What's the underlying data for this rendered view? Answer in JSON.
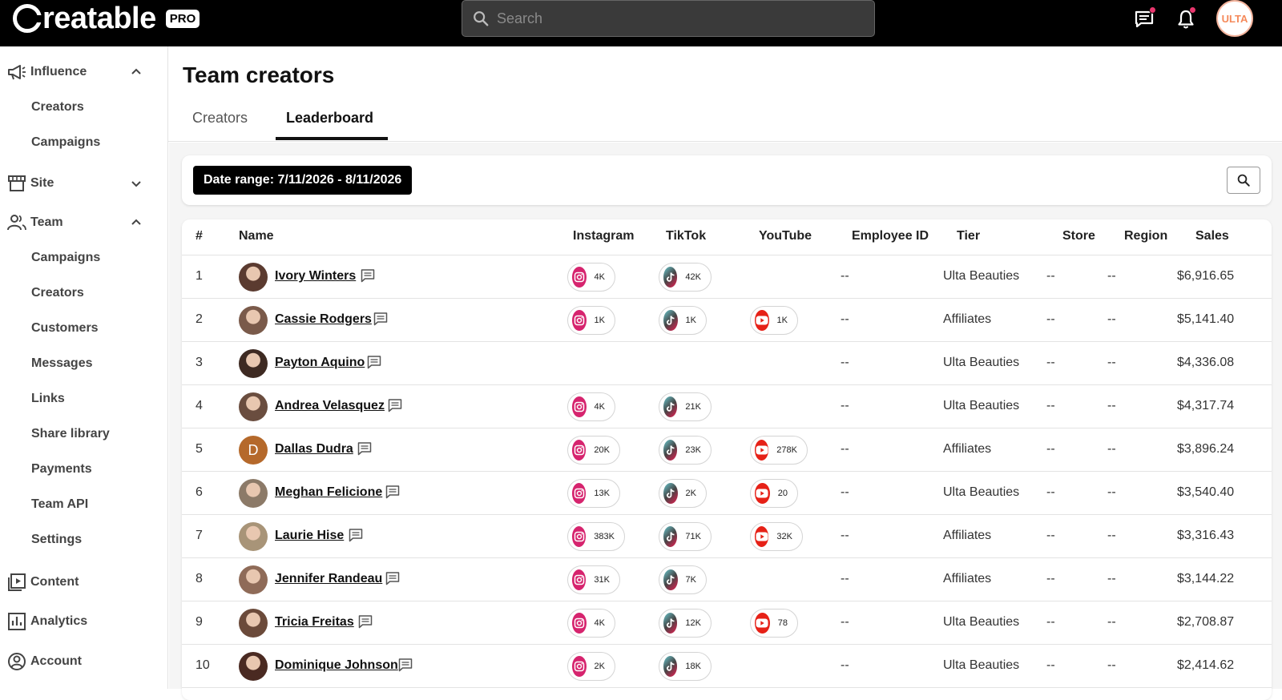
{
  "header": {
    "logo": "Creatable",
    "logo_rest": "reatable",
    "pro_badge": "PRO",
    "search_placeholder": "Search",
    "avatar_text": "ULTA"
  },
  "sidebar": {
    "influence": {
      "label": "Influence",
      "items": [
        "Creators",
        "Campaigns"
      ]
    },
    "site": {
      "label": "Site"
    },
    "team": {
      "label": "Team",
      "items": [
        "Campaigns",
        "Creators",
        "Customers",
        "Messages",
        "Links",
        "Share library",
        "Payments",
        "Team API",
        "Settings"
      ]
    },
    "content": {
      "label": "Content"
    },
    "analytics": {
      "label": "Analytics"
    },
    "account": {
      "label": "Account"
    }
  },
  "main": {
    "title": "Team creators",
    "tabs": [
      "Creators",
      "Leaderboard"
    ],
    "active_tab": "Leaderboard",
    "date_range": "Date range: 7/11/2026 - 8/11/2026"
  },
  "table": {
    "columns": [
      "#",
      "Name",
      "Instagram",
      "TikTok",
      "YouTube",
      "Employee ID",
      "Tier",
      "Store",
      "Region",
      "Sales"
    ],
    "rows": [
      {
        "rank": "1",
        "name": "Ivory Winters",
        "instagram": "4K",
        "tiktok": "42K",
        "youtube": null,
        "employee_id": "--",
        "tier": "Ulta Beauties",
        "store": "--",
        "region": "--",
        "sales": "$6,916.65"
      },
      {
        "rank": "2",
        "name": "Cassie Rodgers",
        "instagram": "1K",
        "tiktok": "1K",
        "youtube": "1K",
        "employee_id": "--",
        "tier": "Affiliates",
        "store": "--",
        "region": "--",
        "sales": "$5,141.40"
      },
      {
        "rank": "3",
        "name": "Payton Aquino",
        "instagram": null,
        "tiktok": null,
        "youtube": null,
        "employee_id": "--",
        "tier": "Ulta Beauties",
        "store": "--",
        "region": "--",
        "sales": "$4,336.08"
      },
      {
        "rank": "4",
        "name": "Andrea Velasquez",
        "instagram": "4K",
        "tiktok": "21K",
        "youtube": null,
        "employee_id": "--",
        "tier": "Ulta Beauties",
        "store": "--",
        "region": "--",
        "sales": "$4,317.74"
      },
      {
        "rank": "5",
        "name": "Dallas Dudra",
        "avatar_letter": "D",
        "instagram": "20K",
        "tiktok": "23K",
        "youtube": "278K",
        "employee_id": "--",
        "tier": "Affiliates",
        "store": "--",
        "region": "--",
        "sales": "$3,896.24"
      },
      {
        "rank": "6",
        "name": "Meghan Felicione",
        "instagram": "13K",
        "tiktok": "2K",
        "youtube": "20",
        "employee_id": "--",
        "tier": "Ulta Beauties",
        "store": "--",
        "region": "--",
        "sales": "$3,540.40"
      },
      {
        "rank": "7",
        "name": "Laurie Hise",
        "instagram": "383K",
        "tiktok": "71K",
        "youtube": "32K",
        "employee_id": "--",
        "tier": "Affiliates",
        "store": "--",
        "region": "--",
        "sales": "$3,316.43"
      },
      {
        "rank": "8",
        "name": "Jennifer Randeau",
        "instagram": "31K",
        "tiktok": "7K",
        "youtube": null,
        "employee_id": "--",
        "tier": "Affiliates",
        "store": "--",
        "region": "--",
        "sales": "$3,144.22"
      },
      {
        "rank": "9",
        "name": "Tricia Freitas",
        "instagram": "4K",
        "tiktok": "12K",
        "youtube": "78",
        "employee_id": "--",
        "tier": "Ulta Beauties",
        "store": "--",
        "region": "--",
        "sales": "$2,708.87"
      },
      {
        "rank": "10",
        "name": "Dominique Johnson",
        "instagram": "2K",
        "tiktok": "18K",
        "youtube": null,
        "employee_id": "--",
        "tier": "Ulta Beauties",
        "store": "--",
        "region": "--",
        "sales": "$2,414.62"
      }
    ]
  },
  "colors": {
    "topbar": "#000000",
    "notification_dot": "#e8366d",
    "instagram": "#d6246e",
    "youtube": "#e62117",
    "tiktok": "#69c9d0"
  },
  "icons": [
    "search-icon",
    "chat-icon",
    "bell-icon",
    "megaphone-icon",
    "store-icon",
    "team-icon",
    "content-icon",
    "analytics-icon",
    "account-icon",
    "chevron-up-icon",
    "chevron-down-icon",
    "message-icon",
    "instagram-icon",
    "tiktok-icon",
    "youtube-icon"
  ]
}
